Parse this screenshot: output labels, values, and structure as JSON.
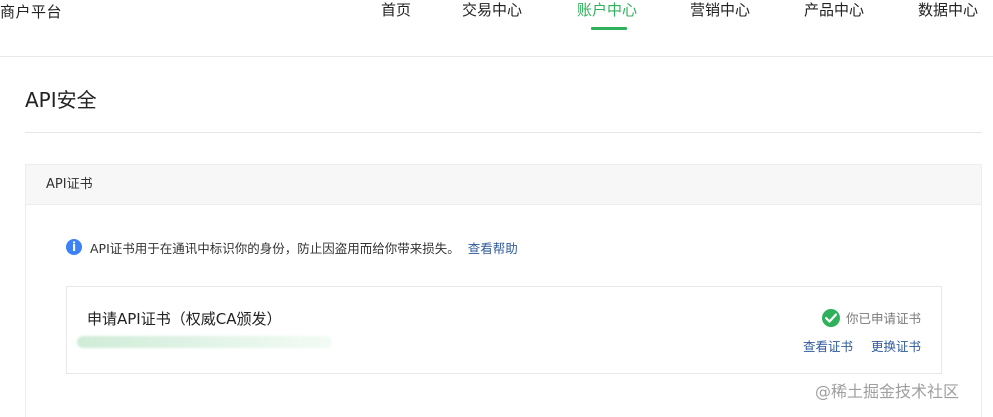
{
  "app": {
    "brand": "商户平台"
  },
  "nav": {
    "items": [
      {
        "label": "首页"
      },
      {
        "label": "交易中心"
      },
      {
        "label": "账户中心"
      },
      {
        "label": "营销中心"
      },
      {
        "label": "产品中心"
      },
      {
        "label": "数据中心"
      }
    ]
  },
  "page": {
    "title": "API安全"
  },
  "card": {
    "header": "API证书",
    "info_text": "API证书用于在通讯中标识你的身份，防止因盗用而给你带来损失。",
    "help_link": "查看帮助",
    "cert": {
      "title": "申请API证书（权威CA颁发）",
      "status": "你已申请证书",
      "actions": [
        {
          "label": "查看证书"
        },
        {
          "label": "更换证书"
        }
      ]
    }
  },
  "watermark": "@稀土掘金技术社区",
  "colors": {
    "active_green": "#2fb15c",
    "link_blue": "#2f5a9b",
    "info_blue": "#3b82f6"
  },
  "icons": {
    "info": "info-icon",
    "check": "check-circle-icon"
  }
}
